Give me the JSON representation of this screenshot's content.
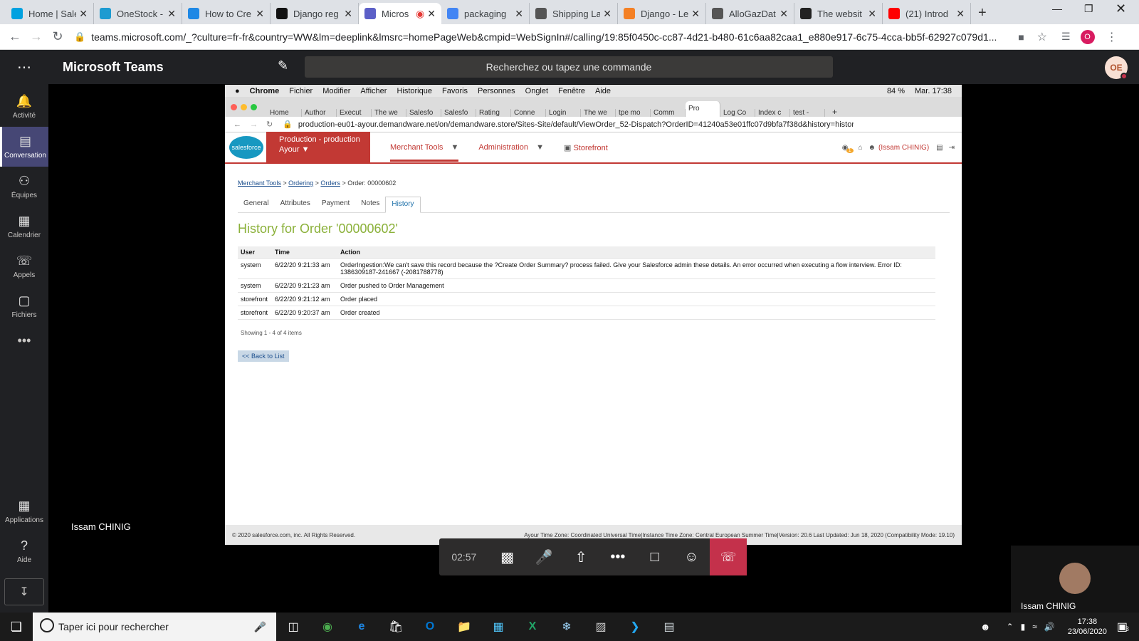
{
  "outer_browser": {
    "tabs": [
      {
        "title": "Home | Sale",
        "color": "#00a1e0",
        "icon": "cloud-icon"
      },
      {
        "title": "OneStock -",
        "color": "#1d9bd1",
        "icon": "cloud-icon"
      },
      {
        "title": "How to Cre",
        "color": "#1e88e5",
        "icon": "s-logo-icon"
      },
      {
        "title": "Django reg",
        "color": "#111111",
        "icon": "medium-icon"
      },
      {
        "title": "Micros",
        "color": "#5b5fc7",
        "icon": "teams-icon"
      },
      {
        "title": "packaging",
        "color": "#4285f4",
        "icon": "google-icon"
      },
      {
        "title": "Shipping La",
        "color": "#555555",
        "icon": "globe-icon"
      },
      {
        "title": "Django - Le",
        "color": "#f48024",
        "icon": "stackoverflow-icon"
      },
      {
        "title": "AlloGazDat",
        "color": "#555555",
        "icon": "globe-icon"
      },
      {
        "title": "The websit",
        "color": "#222222",
        "icon": "power-icon"
      },
      {
        "title": "(21) Introd",
        "color": "#ff0000",
        "icon": "youtube-icon"
      }
    ],
    "url": "teams.microsoft.com/_?culture=fr-fr&country=WW&lm=deeplink&lmsrc=homePageWeb&cmpid=WebSignIn#/calling/19:85f0450c-cc87-4d21-b480-61c6aa82caa1_e880e917-6c75-4cca-bb5f-62927c079d1...",
    "profile_initial": "O"
  },
  "teams": {
    "title": "Microsoft Teams",
    "search_placeholder": "Recherchez ou tapez une commande",
    "avatar_initials": "OE",
    "rail": [
      {
        "label": "Activité",
        "icon": "bell-icon"
      },
      {
        "label": "Conversation",
        "icon": "chat-icon"
      },
      {
        "label": "Équipes",
        "icon": "teams-icon"
      },
      {
        "label": "Calendrier",
        "icon": "calendar-icon"
      },
      {
        "label": "Appels",
        "icon": "phone-icon"
      },
      {
        "label": "Fichiers",
        "icon": "file-icon"
      }
    ],
    "rail_bottom": [
      {
        "label": "Applications",
        "icon": "apps-icon"
      },
      {
        "label": "Aide",
        "icon": "help-icon"
      }
    ],
    "presenter_name": "Issam CHINIG",
    "call_timer": "02:57",
    "self_name": "Issam CHINIG"
  },
  "shared_screen": {
    "mac_menu": [
      "Chrome",
      "Fichier",
      "Modifier",
      "Afficher",
      "Historique",
      "Favoris",
      "Personnes",
      "Onglet",
      "Fenêtre",
      "Aide"
    ],
    "mac_status": {
      "battery": "84 %",
      "clock": "Mar. 17:38"
    },
    "inner_tabs": [
      "Home",
      "Author",
      "Execut",
      "The we",
      "Salesfo",
      "Salesfo",
      "Rating",
      "Conne",
      "Login",
      "The we",
      "tpe mo",
      "Comm",
      "Pro",
      "Log Co",
      "Index c",
      "test -"
    ],
    "inner_url": "production-eu01-ayour.demandware.net/on/demandware.store/Sites-Site/default/ViewOrder_52-Dispatch?OrderID=41240a53e01ffc07d9bfa7f38d&history=history...",
    "sf": {
      "logo": "salesforce",
      "site_line1": "Production - production",
      "site_line2": "Ayour",
      "nav": [
        "Merchant Tools",
        "Administration",
        "Storefront"
      ],
      "user": "(Issam CHINIG)",
      "notif_count": "1"
    },
    "breadcrumb": {
      "items": [
        "Merchant Tools",
        "Ordering",
        "Orders"
      ],
      "current": "Order: 00000602"
    },
    "subtabs": [
      "General",
      "Attributes",
      "Payment",
      "Notes",
      "History"
    ],
    "page_title": "History for Order '00000602'",
    "table": {
      "headers": [
        "User",
        "Time",
        "Action"
      ],
      "rows": [
        [
          "system",
          "6/22/20 9:21:33 am",
          "OrderIngestion:We can't save this record because the ?Create Order Summary? process failed. Give your Salesforce admin these details. An error occurred when executing a flow interview. Error ID: 1386309187-241667 (-2081788778)"
        ],
        [
          "system",
          "6/22/20 9:21:23 am",
          "Order pushed to Order Management"
        ],
        [
          "storefront",
          "6/22/20 9:21:12 am",
          "Order placed"
        ],
        [
          "storefront",
          "6/22/20 9:20:37 am",
          "Order created"
        ]
      ]
    },
    "showing": "Showing 1 - 4 of 4 items",
    "back_label": "<< Back to List",
    "footer_left": "© 2020 salesforce.com, inc. All Rights Reserved.",
    "footer_right": "Ayour Time Zone: Coordinated Universal Time|Instance Time Zone: Central European Summer Time|Version: 20.6 Last Updated: Jun 18, 2020 (Compatibility Mode: 19.10)"
  },
  "taskbar": {
    "search_placeholder": "Taper ici pour rechercher",
    "time": "17:38",
    "date": "23/06/2020",
    "notif_count": "3"
  }
}
